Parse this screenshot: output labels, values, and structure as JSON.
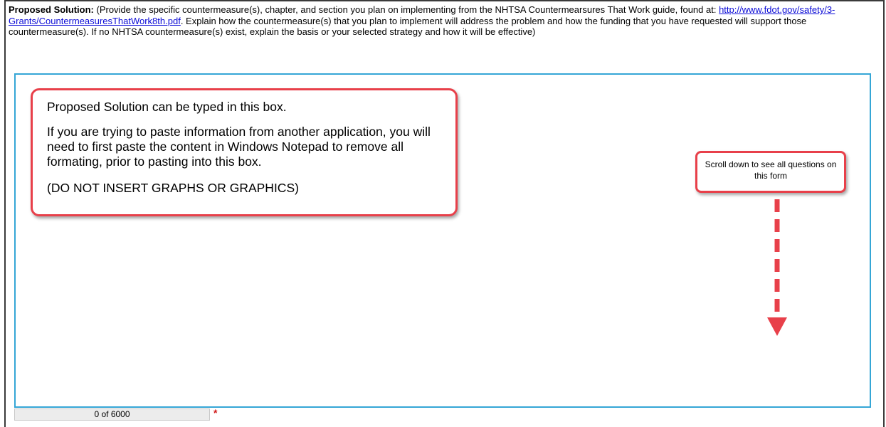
{
  "prompt": {
    "label": "Proposed Solution:",
    "text_before_link": " (Provide the specific countermeasure(s), chapter, and section you plan on implementing from the NHTSA Countermearsures That Work guide, found at: ",
    "link_text": "http://www.fdot.gov/safety/3-Grants/CountermeasuresThatWork8th.pdf",
    "text_after_link": ". Explain how the countermeasure(s) that you plan to implement will address the problem and how the funding that you have requested will support those countermeasure(s).  If no NHTSA countermeasure(s) exist, explain the basis or your selected strategy and how it will be effective)"
  },
  "callout_main": {
    "line1": "Proposed Solution can be typed in this box.",
    "line2": "If you are trying to paste information from another application, you will need to first paste the content in Windows Notepad to remove all formating, prior to pasting into this box.",
    "line3": "(DO NOT INSERT GRAPHS OR GRAPHICS)"
  },
  "callout_scroll": {
    "text": "Scroll down to see all questions on this form"
  },
  "counter": {
    "text": "0 of 6000",
    "required_marker": "*"
  },
  "colors": {
    "callout_border": "#e8404a",
    "textbox_border": "#35a6d6",
    "link": "#0b0bd6",
    "required": "#d01818"
  },
  "icons": {
    "arrow": "dashed-down-arrow-icon"
  }
}
